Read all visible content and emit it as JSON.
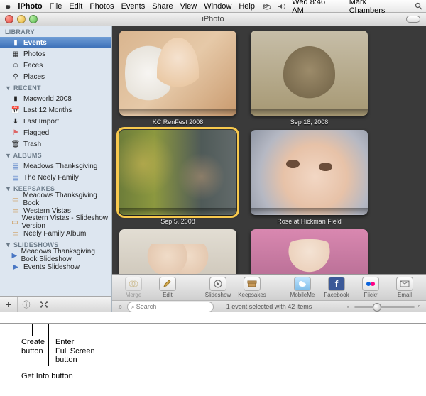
{
  "menubar": {
    "app": "iPhoto",
    "items": [
      "File",
      "Edit",
      "Photos",
      "Events",
      "Share",
      "View",
      "Window",
      "Help"
    ],
    "clock": "Wed 8:46 AM",
    "user": "Mark Chambers"
  },
  "window": {
    "title": "iPhoto"
  },
  "sidebar": {
    "sections": [
      {
        "header": "LIBRARY",
        "items": [
          {
            "label": "Events",
            "selected": true,
            "icon": "events-icon"
          },
          {
            "label": "Photos",
            "icon": "photos-icon"
          },
          {
            "label": "Faces",
            "icon": "faces-icon"
          },
          {
            "label": "Places",
            "icon": "places-icon"
          }
        ]
      },
      {
        "header": "▼ RECENT",
        "items": [
          {
            "label": "Macworld 2008",
            "icon": "event-icon"
          },
          {
            "label": "Last 12 Months",
            "icon": "calendar-icon"
          },
          {
            "label": "Last Import",
            "icon": "import-icon"
          },
          {
            "label": "Flagged",
            "icon": "flag-icon"
          },
          {
            "label": "Trash",
            "icon": "trash-icon"
          }
        ]
      },
      {
        "header": "▼ ALBUMS",
        "items": [
          {
            "label": "Meadows Thanksgiving",
            "icon": "album-icon"
          },
          {
            "label": "The Neely Family",
            "icon": "album-icon"
          }
        ]
      },
      {
        "header": "▼ KEEPSAKES",
        "items": [
          {
            "label": "Meadows Thanksgiving Book",
            "icon": "book-icon"
          },
          {
            "label": "Western Vistas",
            "icon": "book-icon"
          },
          {
            "label": "Western Vistas - Slideshow Version",
            "icon": "book-icon"
          },
          {
            "label": "Neely Family Album",
            "icon": "book-icon"
          }
        ]
      },
      {
        "header": "▼ SLIDESHOWS",
        "items": [
          {
            "label": "Meadows Thanksgiving Book Slideshow",
            "icon": "slideshow-icon"
          },
          {
            "label": "Events Slideshow",
            "icon": "slideshow-icon"
          }
        ]
      }
    ]
  },
  "events": [
    {
      "caption": "KC RenFest 2008",
      "cls": "girl"
    },
    {
      "caption": "Sep 18, 2008",
      "cls": "cat"
    },
    {
      "caption": "Sep 5, 2008",
      "cls": "renfest",
      "selected": true
    },
    {
      "caption": "Rose at Hickman Field",
      "cls": "face"
    },
    {
      "caption": "",
      "cls": "couch"
    },
    {
      "caption": "",
      "cls": "pink"
    }
  ],
  "toolbar": {
    "left": [
      {
        "label": "Merge",
        "disabled": true,
        "icon": "merge-icon"
      },
      {
        "label": "Edit",
        "icon": "pencil-icon"
      }
    ],
    "mid": [
      {
        "label": "Slideshow",
        "icon": "play-icon"
      },
      {
        "label": "Keepsakes",
        "icon": "box-icon"
      }
    ],
    "right": [
      {
        "label": "MobileMe",
        "icon": "mobileme-icon"
      },
      {
        "label": "Facebook",
        "icon": "facebook-icon"
      },
      {
        "label": "Flickr",
        "icon": "flickr-icon"
      },
      {
        "label": "Email",
        "icon": "mail-icon"
      }
    ]
  },
  "status": {
    "text": "1 event selected with 42 items"
  },
  "search": {
    "placeholder": "Search",
    "zoom_glyph": "⌕"
  },
  "annotations": {
    "create": "Create\nbutton",
    "getinfo": "Get Info button",
    "fullscreen": "Enter\nFull Screen\nbutton"
  }
}
